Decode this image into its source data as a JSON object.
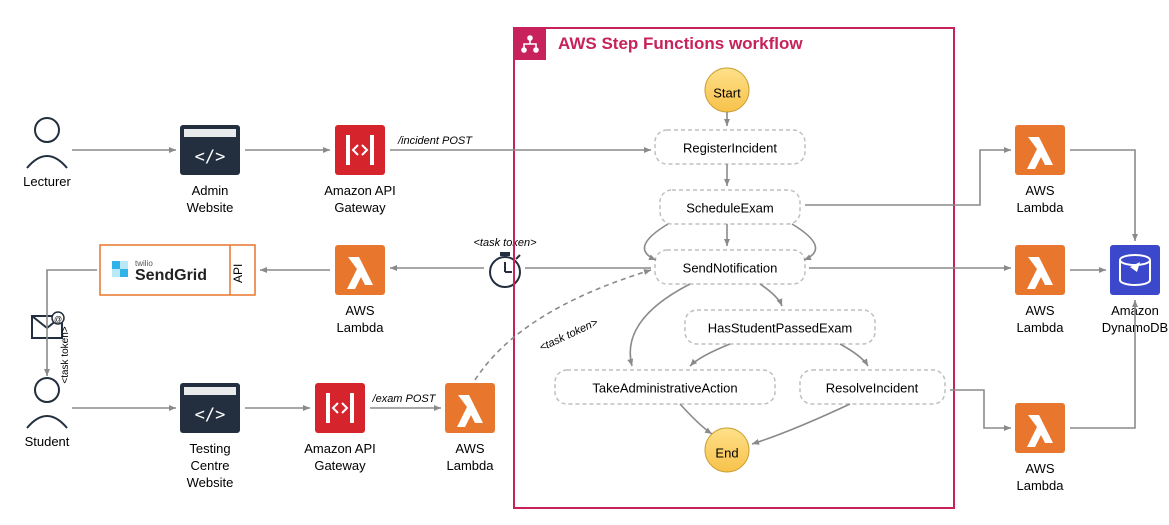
{
  "actors": {
    "lecturer": "Lecturer",
    "student": "Student"
  },
  "websites": {
    "admin": {
      "line1": "Admin",
      "line2": "Website"
    },
    "testing": {
      "line1": "Testing",
      "line2": "Centre",
      "line3": "Website"
    }
  },
  "services": {
    "api_gateway": {
      "line1": "Amazon API",
      "line2": "Gateway"
    },
    "lambda": {
      "line1": "AWS",
      "line2": "Lambda"
    },
    "dynamodb": {
      "line1": "Amazon",
      "line2": "DynamoDB"
    }
  },
  "sendgrid": {
    "brand": "SendGrid",
    "prefix": "twilio",
    "api": "API"
  },
  "endpoints": {
    "incident": "/incident POST",
    "exam": "/exam POST"
  },
  "tokens": {
    "task_token": "<task token>"
  },
  "workflow": {
    "title": "AWS Step Functions workflow",
    "start": "Start",
    "end": "End",
    "states": {
      "register": "RegisterIncident",
      "schedule": "ScheduleExam",
      "notify": "SendNotification",
      "passed": "HasStudentPassedExam",
      "admin_action": "TakeAdministrativeAction",
      "resolve": "ResolveIncident"
    }
  }
}
